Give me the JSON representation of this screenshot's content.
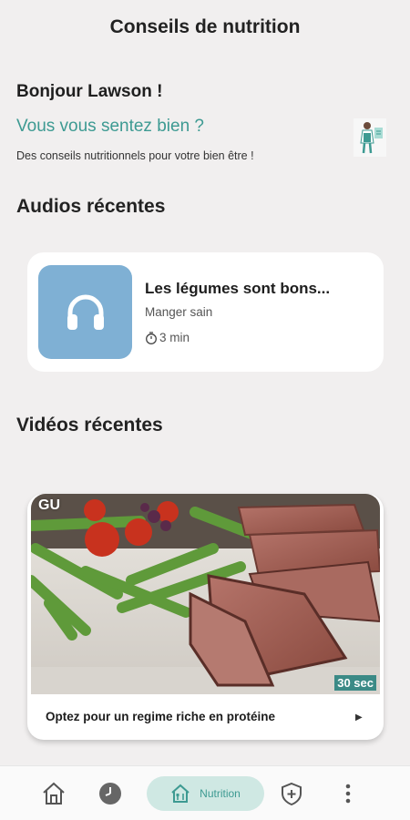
{
  "header": {
    "title": "Conseils de nutrition"
  },
  "welcome": {
    "greeting": "Bonjour Lawson !",
    "question": "Vous vous sentez bien ?",
    "subtitle": "Des conseils nutritionnels pour votre bien être !"
  },
  "audios": {
    "section_title": "Audios récentes",
    "items": [
      {
        "title": "Les légumes sont bons...",
        "category": "Manger sain",
        "duration": "3 min",
        "icon": "headphones-icon"
      }
    ]
  },
  "videos": {
    "section_title": "Vidéos récentes",
    "items": [
      {
        "badge_left": "GU",
        "duration": "30 sec",
        "caption": "Optez pour un regime riche en protéine",
        "play_symbol": "▶"
      }
    ]
  },
  "bottom_nav": {
    "items": [
      {
        "icon": "home-icon"
      },
      {
        "icon": "clock-icon"
      },
      {
        "icon": "nutrition-icon",
        "label": "Nutrition",
        "active": true
      },
      {
        "icon": "shield-icon"
      },
      {
        "icon": "more-vertical-icon"
      }
    ]
  },
  "colors": {
    "background": "#f1efef",
    "accent": "#3d9a92",
    "audio_thumb": "#7fb0d4",
    "nav_active": "#cfe8e3",
    "video_badge": "#3b8a86"
  }
}
